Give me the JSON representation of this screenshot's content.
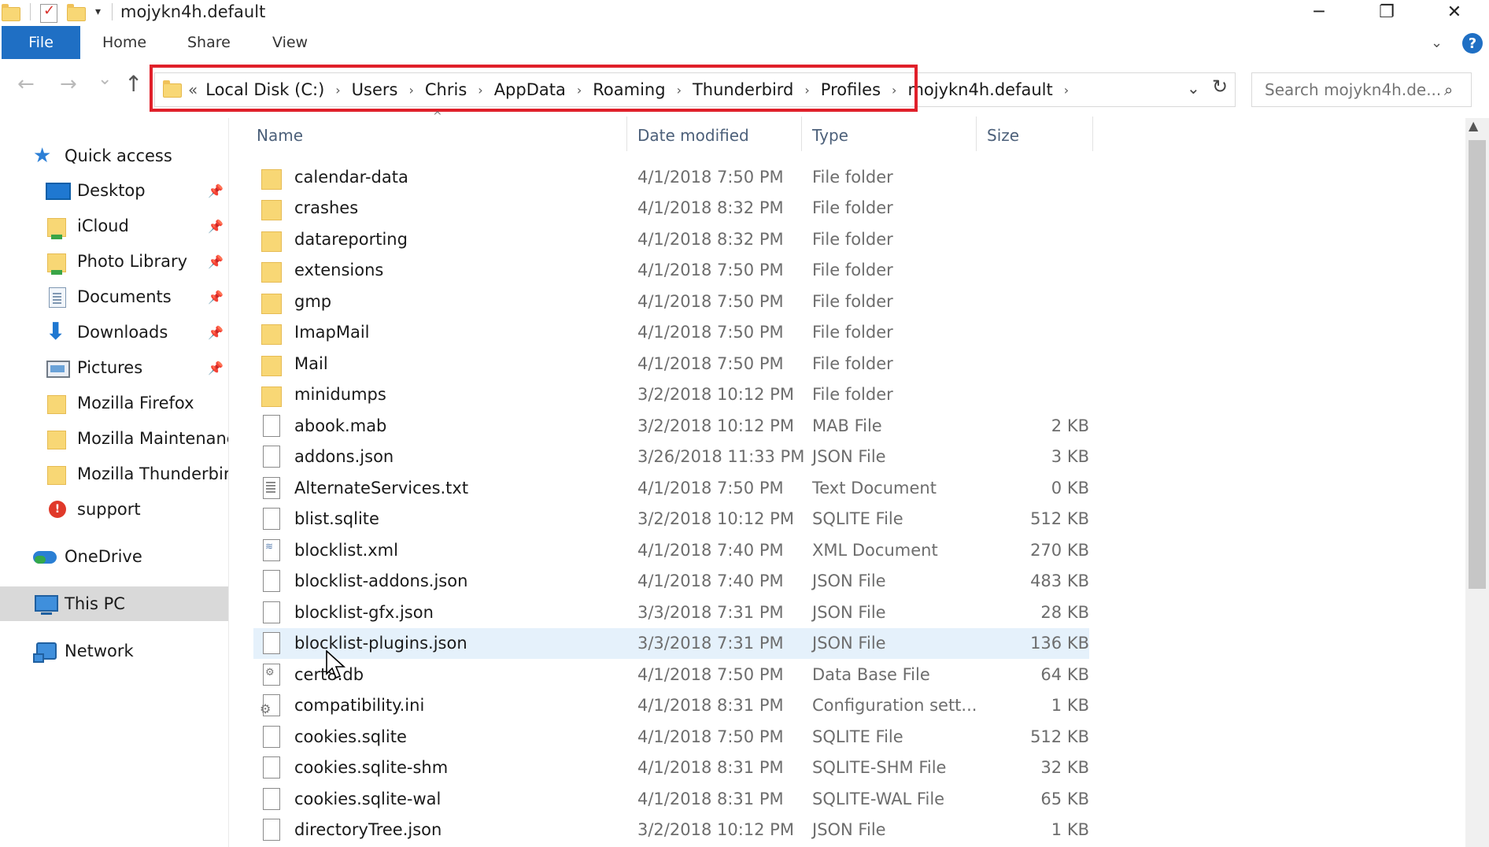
{
  "window": {
    "title": "mojykn4h.default",
    "controls": {
      "minimize": "─",
      "restore": "❐",
      "close": "✕"
    }
  },
  "ribbon": {
    "file": "File",
    "tabs": [
      "Home",
      "Share",
      "View"
    ],
    "help": "?"
  },
  "nav": {
    "back": "←",
    "forward": "→",
    "recent": "⌄",
    "up": "↑",
    "lead": "«",
    "breadcrumb": [
      "Local Disk (C:)",
      "Users",
      "Chris",
      "AppData",
      "Roaming",
      "Thunderbird",
      "Profiles",
      "mojykn4h.default"
    ],
    "separator": "›",
    "dropdown": "⌄",
    "refresh": "↻",
    "search_placeholder": "Search mojykn4h.de...",
    "search_icon": "⌕"
  },
  "sidebar": {
    "quick_access": "Quick access",
    "items": [
      {
        "label": "Desktop",
        "icon": "desktop-icon",
        "pinned": true
      },
      {
        "label": "iCloud",
        "icon": "folder-icon",
        "pinned": true
      },
      {
        "label": "Photo Library",
        "icon": "folder-icon",
        "pinned": true
      },
      {
        "label": "Documents",
        "icon": "documents-icon",
        "pinned": true
      },
      {
        "label": "Downloads",
        "icon": "download-icon",
        "pinned": true
      },
      {
        "label": "Pictures",
        "icon": "pictures-icon",
        "pinned": true
      },
      {
        "label": "Mozilla Firefox",
        "icon": "folder-icon",
        "pinned": false
      },
      {
        "label": "Mozilla Maintenance Service",
        "icon": "folder-icon",
        "pinned": false
      },
      {
        "label": "Mozilla Thunderbird",
        "icon": "folder-icon",
        "pinned": false
      },
      {
        "label": "support",
        "icon": "support-icon",
        "pinned": false
      }
    ],
    "onedrive": "OneDrive",
    "this_pc": "This PC",
    "network": "Network",
    "pin_glyph": "📌"
  },
  "columns": {
    "name": "Name",
    "date": "Date modified",
    "type": "Type",
    "size": "Size"
  },
  "files": [
    {
      "name": "calendar-data",
      "date": "4/1/2018 7:50 PM",
      "type": "File folder",
      "size": "",
      "kind": "folder"
    },
    {
      "name": "crashes",
      "date": "4/1/2018 8:32 PM",
      "type": "File folder",
      "size": "",
      "kind": "folder"
    },
    {
      "name": "datareporting",
      "date": "4/1/2018 8:32 PM",
      "type": "File folder",
      "size": "",
      "kind": "folder"
    },
    {
      "name": "extensions",
      "date": "4/1/2018 7:50 PM",
      "type": "File folder",
      "size": "",
      "kind": "folder"
    },
    {
      "name": "gmp",
      "date": "4/1/2018 7:50 PM",
      "type": "File folder",
      "size": "",
      "kind": "folder"
    },
    {
      "name": "ImapMail",
      "date": "4/1/2018 7:50 PM",
      "type": "File folder",
      "size": "",
      "kind": "folder"
    },
    {
      "name": "Mail",
      "date": "4/1/2018 7:50 PM",
      "type": "File folder",
      "size": "",
      "kind": "folder"
    },
    {
      "name": "minidumps",
      "date": "3/2/2018 10:12 PM",
      "type": "File folder",
      "size": "",
      "kind": "folder"
    },
    {
      "name": "abook.mab",
      "date": "3/2/2018 10:12 PM",
      "type": "MAB File",
      "size": "2 KB",
      "kind": "file"
    },
    {
      "name": "addons.json",
      "date": "3/26/2018 11:33 PM",
      "type": "JSON File",
      "size": "3 KB",
      "kind": "file"
    },
    {
      "name": "AlternateServices.txt",
      "date": "4/1/2018 7:50 PM",
      "type": "Text Document",
      "size": "0 KB",
      "kind": "text"
    },
    {
      "name": "blist.sqlite",
      "date": "3/2/2018 10:12 PM",
      "type": "SQLITE File",
      "size": "512 KB",
      "kind": "file"
    },
    {
      "name": "blocklist.xml",
      "date": "4/1/2018 7:40 PM",
      "type": "XML Document",
      "size": "270 KB",
      "kind": "xml"
    },
    {
      "name": "blocklist-addons.json",
      "date": "4/1/2018 7:40 PM",
      "type": "JSON File",
      "size": "483 KB",
      "kind": "file"
    },
    {
      "name": "blocklist-gfx.json",
      "date": "3/3/2018 7:31 PM",
      "type": "JSON File",
      "size": "28 KB",
      "kind": "file"
    },
    {
      "name": "blocklist-plugins.json",
      "date": "3/3/2018 7:31 PM",
      "type": "JSON File",
      "size": "136 KB",
      "kind": "file",
      "hover": true
    },
    {
      "name": "cert8.db",
      "date": "4/1/2018 7:50 PM",
      "type": "Data Base File",
      "size": "64 KB",
      "kind": "db"
    },
    {
      "name": "compatibility.ini",
      "date": "4/1/2018 8:31 PM",
      "type": "Configuration sett...",
      "size": "1 KB",
      "kind": "gear"
    },
    {
      "name": "cookies.sqlite",
      "date": "4/1/2018 7:50 PM",
      "type": "SQLITE File",
      "size": "512 KB",
      "kind": "file"
    },
    {
      "name": "cookies.sqlite-shm",
      "date": "4/1/2018 8:31 PM",
      "type": "SQLITE-SHM File",
      "size": "32 KB",
      "kind": "file"
    },
    {
      "name": "cookies.sqlite-wal",
      "date": "4/1/2018 8:31 PM",
      "type": "SQLITE-WAL File",
      "size": "65 KB",
      "kind": "file"
    },
    {
      "name": "directoryTree.json",
      "date": "3/2/2018 10:12 PM",
      "type": "JSON File",
      "size": "1 KB",
      "kind": "file"
    }
  ],
  "colors": {
    "accent": "#1f6fc4",
    "highlight_border": "#e0202a",
    "row_hover": "#e5f1fb",
    "folder": "#f8d775"
  }
}
